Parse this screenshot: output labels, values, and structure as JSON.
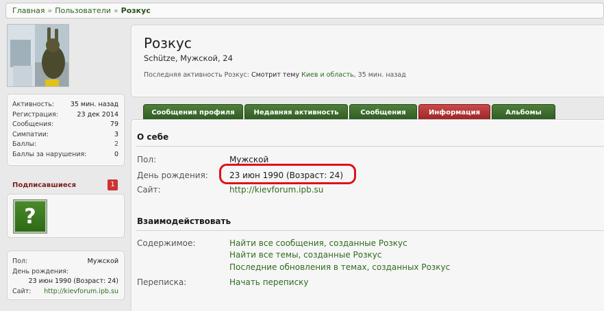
{
  "breadcrumb": {
    "home": "Главная",
    "users": "Пользователи",
    "current": "Розкус",
    "separator": "»"
  },
  "stats": [
    {
      "key": "Активность:",
      "value": "35 мин. назад",
      "link": false
    },
    {
      "key": "Регистрация:",
      "value": "23 дек 2014",
      "link": false
    },
    {
      "key": "Сообщения:",
      "value": "79",
      "link": false
    },
    {
      "key": "Симпатии:",
      "value": "3",
      "link": false
    },
    {
      "key": "Баллы:",
      "value": "2",
      "link": true
    },
    {
      "key": "Баллы за нарушения:",
      "value": "0",
      "link": false
    }
  ],
  "subscribed": {
    "label": "Подписавшиеся",
    "count": "1",
    "icon_glyph": "?"
  },
  "sidebar_info": {
    "gender_label": "Пол:",
    "gender": "Мужской",
    "birthday_label": "День рождения:",
    "birthday": "23 июн 1990 (Возраст: 24)",
    "site_label": "Сайт:",
    "site": "http://kievforum.ipb.su"
  },
  "profile": {
    "name": "Розкус",
    "subtitle": "Schütze, Мужской, 24",
    "activity_prefix": "Последняя активность Розкус:",
    "activity_action": "Смотрит тему",
    "activity_topic": "Киев и область",
    "activity_time": ", 35 мин. назад"
  },
  "tabs": [
    {
      "label": "Сообщения профиля",
      "active": false
    },
    {
      "label": "Недавняя активность",
      "active": false
    },
    {
      "label": "Сообщения",
      "active": false
    },
    {
      "label": "Информация",
      "active": true
    },
    {
      "label": "Альбомы",
      "active": false
    }
  ],
  "about": {
    "heading": "О себе",
    "gender_label": "Пол:",
    "gender": "Мужской",
    "birthday_label": "День рождения:",
    "birthday": "23 июн 1990 (Возраст: 24)",
    "site_label": "Сайт:",
    "site": "http://kievforum.ipb.su"
  },
  "interact": {
    "heading": "Взаимодействовать",
    "content_label": "Содержимое:",
    "link1": "Найти все сообщения, созданные Розкус",
    "link2": "Найти все темы, созданные Розкус",
    "link3": "Последние обновления в темах, созданных Розкус",
    "pm_label": "Переписка:",
    "pm_link": "Начать переписку"
  },
  "colors": {
    "accent_green": "#2f6b1f",
    "tab_green": "#2f5b22",
    "tab_active": "#9c2525",
    "highlight_circle": "#e0101a"
  }
}
